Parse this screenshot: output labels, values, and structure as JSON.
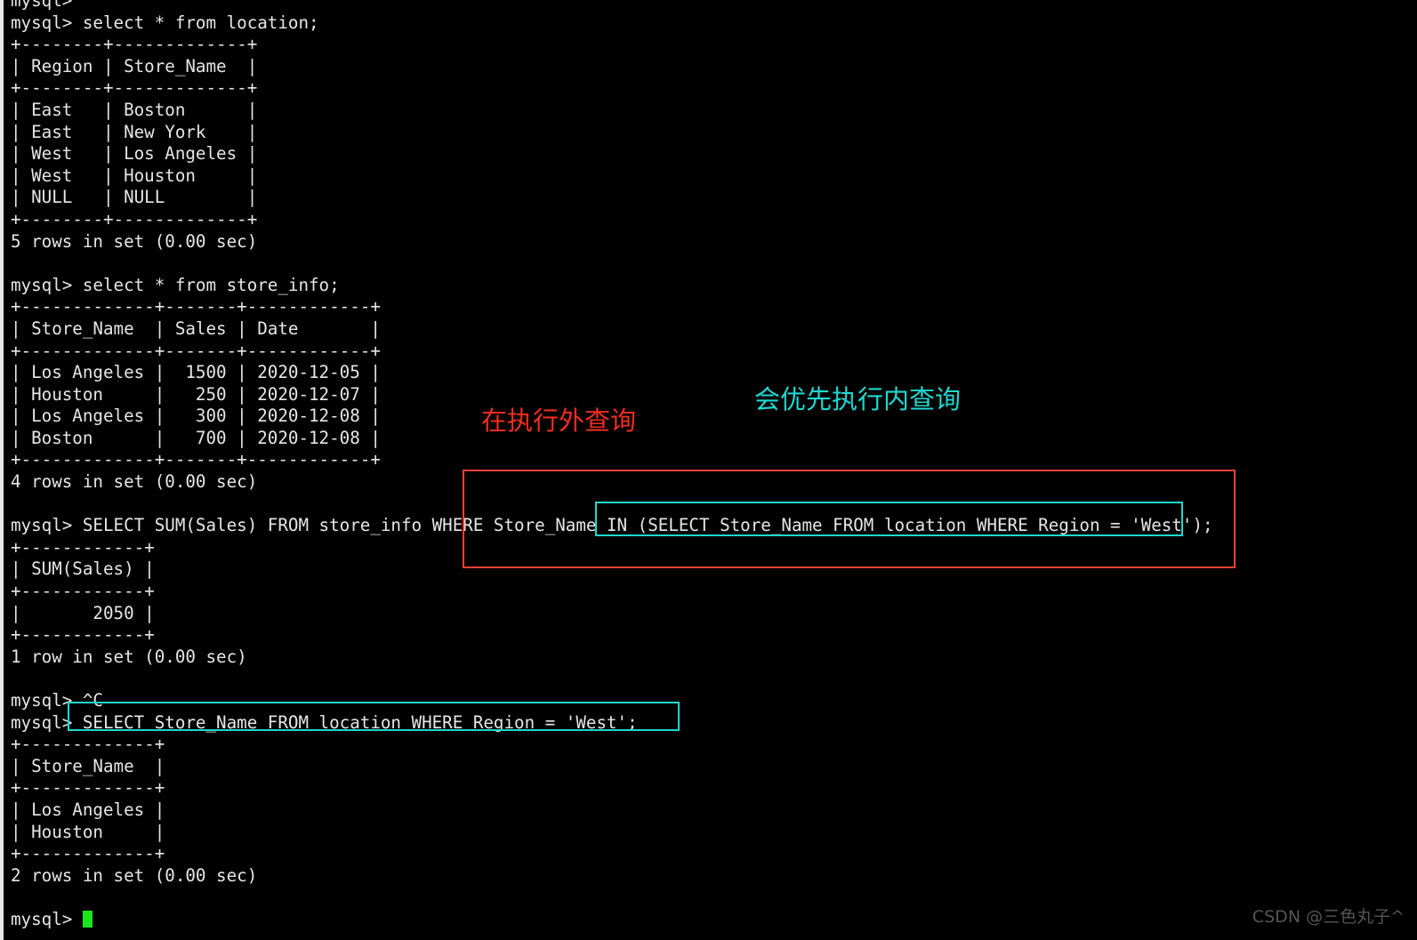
{
  "terminal": {
    "lines": [
      "mysql>",
      "mysql> select * from location;",
      "+--------+-------------+",
      "| Region | Store_Name  |",
      "+--------+-------------+",
      "| East   | Boston      |",
      "| East   | New York    |",
      "| West   | Los Angeles |",
      "| West   | Houston     |",
      "| NULL   | NULL        |",
      "+--------+-------------+",
      "5 rows in set (0.00 sec)",
      "",
      "mysql> select * from store_info;",
      "+-------------+-------+------------+",
      "| Store_Name  | Sales | Date       |",
      "+-------------+-------+------------+",
      "| Los Angeles |  1500 | 2020-12-05 |",
      "| Houston     |   250 | 2020-12-07 |",
      "| Los Angeles |   300 | 2020-12-08 |",
      "| Boston      |   700 | 2020-12-08 |",
      "+-------------+-------+------------+",
      "4 rows in set (0.00 sec)",
      "",
      "mysql> SELECT SUM(Sales) FROM store_info WHERE Store_Name IN (SELECT Store_Name FROM location WHERE Region = 'West');",
      "+------------+",
      "| SUM(Sales) |",
      "+------------+",
      "|       2050 |",
      "+------------+",
      "1 row in set (0.00 sec)",
      "",
      "mysql> ^C",
      "mysql> SELECT Store_Name FROM location WHERE Region = 'West';",
      "+-------------+",
      "| Store_Name  |",
      "+-------------+",
      "| Los Angeles |",
      "| Houston     |",
      "+-------------+",
      "2 rows in set (0.00 sec)",
      ""
    ],
    "prompt": "mysql> ",
    "cursor_color": "#19e619",
    "text_color": "#e6e6e6",
    "background_color": "#000000"
  },
  "annotations": {
    "outer_query_label": "在执行外查询",
    "inner_query_label": "会优先执行内查询",
    "outer_query_color": "#f22c20",
    "inner_query_color": "#1fd8d0",
    "outer_box_color": "#ef4136",
    "inner_box_color": "#1fd8d0"
  },
  "watermark": {
    "text": "CSDN @三色丸子^"
  }
}
